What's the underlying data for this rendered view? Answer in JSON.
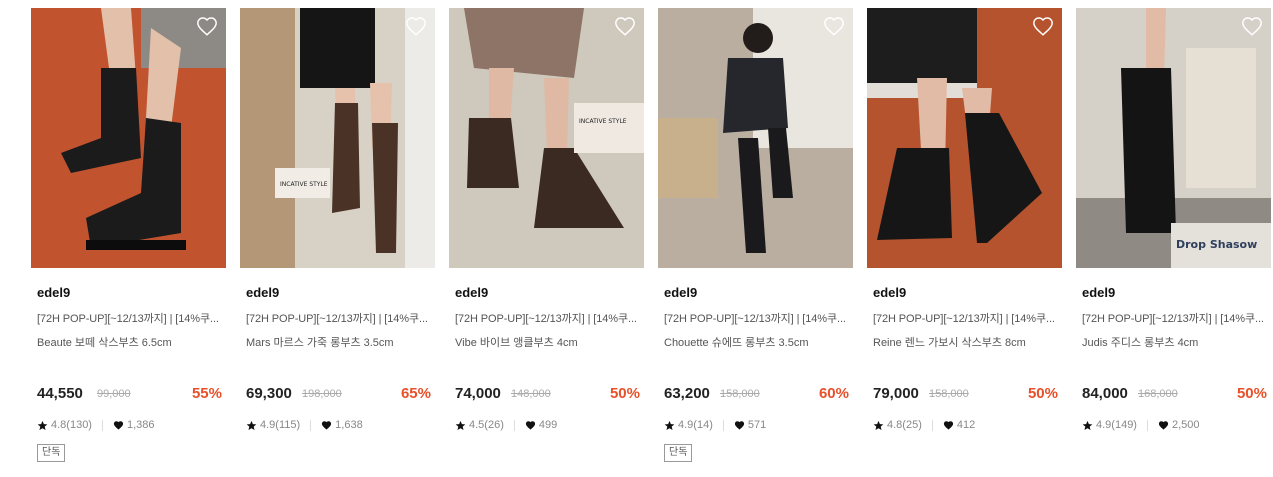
{
  "products": [
    {
      "brand": "edel9",
      "title": "[72H POP-UP][~12/13까지] | [14%쿠...",
      "subtitle": "Beaute 보떼 삭스부츠 6.5cm",
      "price": "44,550",
      "original_price": "99,000",
      "discount": "55%",
      "rating": "4.8(130)",
      "likes": "1,386",
      "badge": "단독",
      "heart_icon": "heart-outline-icon",
      "bg": "#c2532f",
      "boot": "#1b1b1b"
    },
    {
      "brand": "edel9",
      "title": "[72H POP-UP][~12/13까지] | [14%쿠...",
      "subtitle": "Mars 마르스 가죽 롱부츠 3.5cm",
      "price": "69,300",
      "original_price": "198,000",
      "discount": "65%",
      "rating": "4.9(115)",
      "likes": "1,638",
      "badge": "",
      "heart_icon": "heart-outline-icon",
      "bg": "#d8d1c6",
      "boot": "#4a3226"
    },
    {
      "brand": "edel9",
      "title": "[72H POP-UP][~12/13까지] | [14%쿠...",
      "subtitle": "Vibe 바이브 앵클부츠 4cm",
      "price": "74,000",
      "original_price": "148,000",
      "discount": "50%",
      "rating": "4.5(26)",
      "likes": "499",
      "badge": "",
      "heart_icon": "heart-outline-icon",
      "bg": "#cfc8bd",
      "boot": "#3b2a22"
    },
    {
      "brand": "edel9",
      "title": "[72H POP-UP][~12/13까지] | [14%쿠...",
      "subtitle": "Chouette 슈에뜨 롱부츠 3.5cm",
      "price": "63,200",
      "original_price": "158,000",
      "discount": "60%",
      "rating": "4.9(14)",
      "likes": "571",
      "badge": "단독",
      "heart_icon": "heart-outline-icon",
      "bg": "#b9aea0",
      "boot": "#1a1a1c"
    },
    {
      "brand": "edel9",
      "title": "[72H POP-UP][~12/13까지] | [14%쿠...",
      "subtitle": "Reine 렌느 가보시 삭스부츠 8cm",
      "price": "79,000",
      "original_price": "158,000",
      "discount": "50%",
      "rating": "4.8(25)",
      "likes": "412",
      "badge": "",
      "heart_icon": "heart-outline-icon",
      "bg": "#b5532e",
      "boot": "#161616"
    },
    {
      "brand": "edel9",
      "title": "[72H POP-UP][~12/13까지] | [14%쿠...",
      "subtitle": "Judis 주디스 롱부츠 4cm",
      "price": "84,000",
      "original_price": "168,000",
      "discount": "50%",
      "rating": "4.9(149)",
      "likes": "2,500",
      "badge": "",
      "heart_icon": "heart-outline-icon",
      "bg": "#8f8a83",
      "boot": "#141414"
    }
  ],
  "photo_text": {
    "p2_book": "INCATIVE STYLE",
    "p3_book": "INCATIVE STYLE",
    "p6_book": "Drop Shasow"
  },
  "colors": {
    "accent": "#e8502a",
    "text": "#222222",
    "muted": "#888888"
  }
}
